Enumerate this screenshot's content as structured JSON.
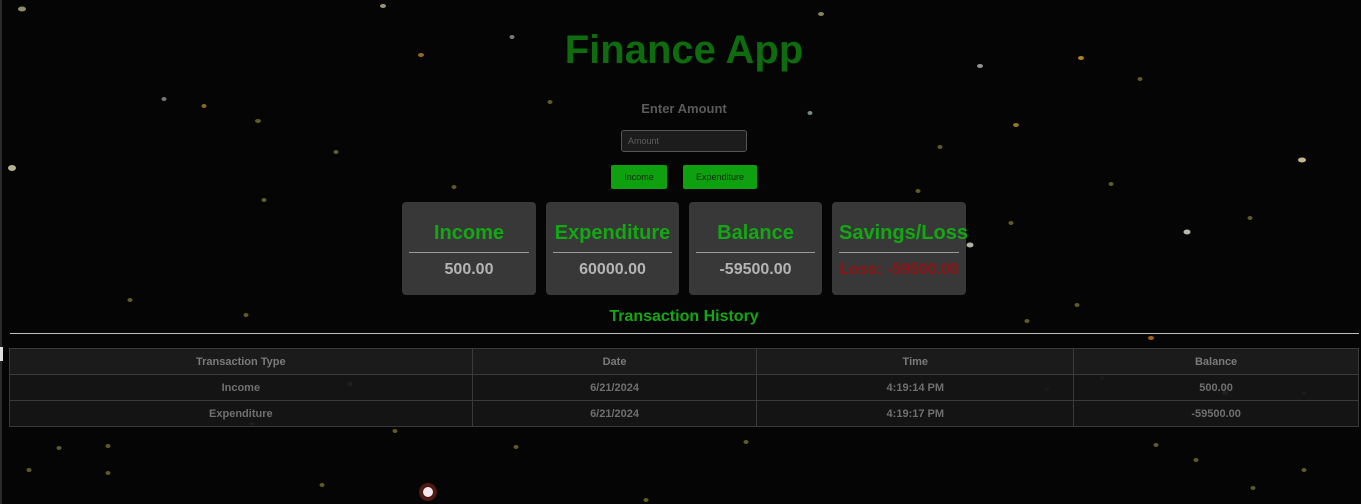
{
  "app": {
    "title": "Finance App"
  },
  "entry": {
    "label": "Enter Amount",
    "amount_placeholder": "Amount",
    "amount_value": "",
    "income_button": "Income",
    "expenditure_button": "Expenditure"
  },
  "summary": [
    {
      "title": "Income",
      "value": "500.00"
    },
    {
      "title": "Expenditure",
      "value": "60000.00"
    },
    {
      "title": "Balance",
      "value": "-59500.00"
    },
    {
      "title": "Savings/Loss",
      "value": "Loss: -59500.00"
    }
  ],
  "history": {
    "title": "Transaction History",
    "columns": [
      "Transaction Type",
      "Date",
      "Time",
      "Balance"
    ],
    "rows": [
      [
        "Income",
        "6/21/2024",
        "4:19:14 PM",
        "500.00"
      ],
      [
        "Expenditure",
        "6/21/2024",
        "4:19:17 PM",
        "-59500.00"
      ]
    ]
  },
  "colors": {
    "background": "#050505",
    "title_green": "#0e6b0e",
    "accent_green": "#13a813",
    "button_green": "#0fa00f",
    "card_bg": "#383838",
    "loss_red": "#8e1414"
  }
}
